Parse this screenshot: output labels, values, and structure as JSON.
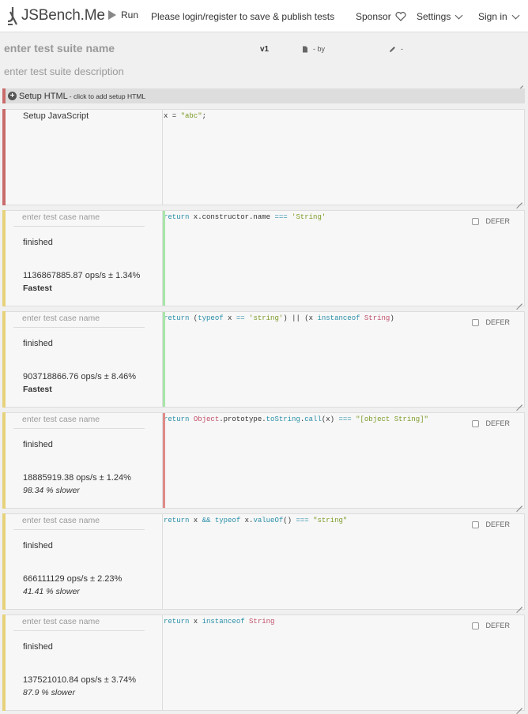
{
  "header": {
    "logo_text": "JSBench.Me",
    "run_label": "Run",
    "login_message": "Please login/register to save & publish tests",
    "sponsor_label": "Sponsor",
    "settings_label": "Settings",
    "signin_label": "Sign in"
  },
  "suite": {
    "name_placeholder": "enter test suite name",
    "description_placeholder": "enter test suite description",
    "version": "v1",
    "by_label": "- by",
    "edit_label": "-"
  },
  "setup_html": {
    "title": "Setup HTML",
    "hint": " - click to add setup HTML"
  },
  "setup_js": {
    "label": "Setup JavaScript",
    "code": "x = \"abc\";"
  },
  "test_cases": [
    {
      "name_placeholder": "enter test case name",
      "status": "finished",
      "ops": "1136867885.87 ops/s ± 1.34%",
      "rank": "Fastest",
      "defer_label": "DEFER"
    },
    {
      "name_placeholder": "enter test case name",
      "status": "finished",
      "ops": "903718866.76 ops/s ± 8.46%",
      "rank": "Fastest",
      "defer_label": "DEFER"
    },
    {
      "name_placeholder": "enter test case name",
      "status": "finished",
      "ops": "18885919.38 ops/s ± 1.24%",
      "rank": "98.34 % slower",
      "defer_label": "DEFER"
    },
    {
      "name_placeholder": "enter test case name",
      "status": "finished",
      "ops": "666111129 ops/s ± 2.23%",
      "rank": "41.41 % slower",
      "defer_label": "DEFER"
    },
    {
      "name_placeholder": "enter test case name",
      "status": "finished",
      "ops": "137521010.84 ops/s ± 3.74%",
      "rank": "87.9 % slower",
      "defer_label": "DEFER"
    }
  ],
  "colors": {
    "setup_bar": "#c96b6b",
    "case_bar": "#e6d27a",
    "fast_code_bar": "#a8e6a8",
    "slow_code_bar": "#e08a8a"
  }
}
